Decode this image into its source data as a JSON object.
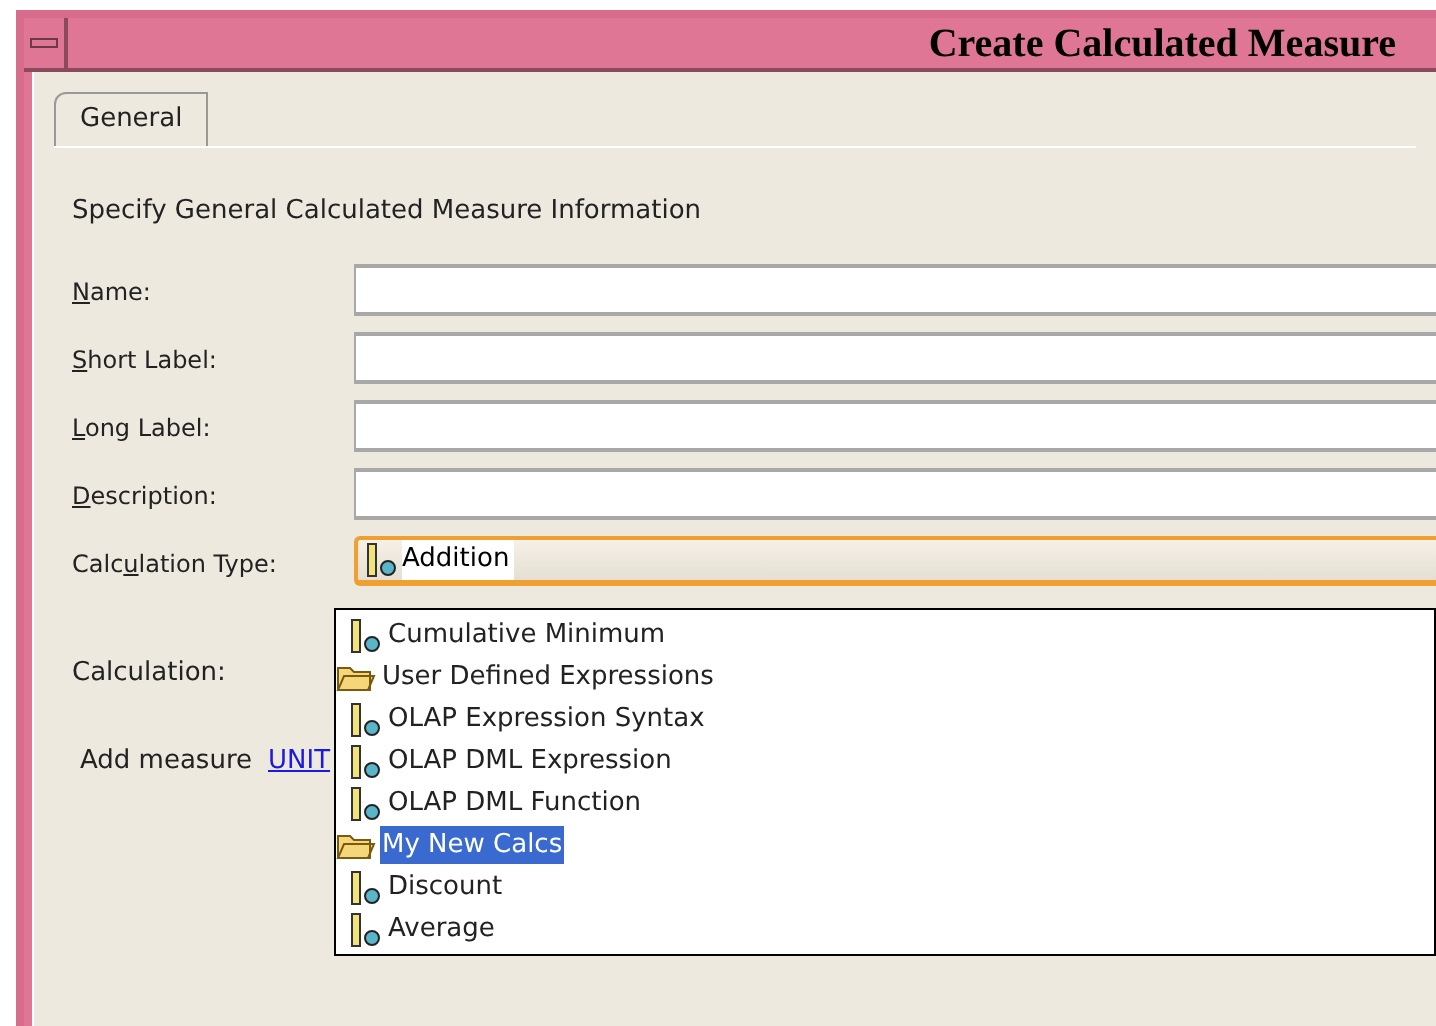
{
  "window": {
    "title": "Create Calculated Measure"
  },
  "tabs": [
    {
      "label": "General",
      "selected": true
    }
  ],
  "heading": "Specify General Calculated Measure Information",
  "fields": [
    {
      "label": [
        {
          "text": "N",
          "underlined": true
        },
        {
          "text": "ame:",
          "underlined": false
        }
      ]
    },
    {
      "label": [
        {
          "text": "S",
          "underlined": true
        },
        {
          "text": "hort Label:",
          "underlined": false
        }
      ]
    },
    {
      "label": [
        {
          "text": "L",
          "underlined": true
        },
        {
          "text": "ong Label:",
          "underlined": false
        }
      ]
    },
    {
      "label": [
        {
          "text": "D",
          "underlined": true
        },
        {
          "text": "escription:",
          "underlined": false
        }
      ]
    }
  ],
  "calculation_type": {
    "label": [
      {
        "text": "Calc",
        "underlined": false
      },
      {
        "text": "u",
        "underlined": true
      },
      {
        "text": "lation Type:",
        "underlined": false
      }
    ],
    "value": "Addition",
    "expanded": true,
    "options": [
      {
        "kind": "measure",
        "label": "Cumulative Minimum",
        "selected": false
      },
      {
        "kind": "folder",
        "label": "User Defined Expressions",
        "selected": false
      },
      {
        "kind": "measure",
        "label": "OLAP Expression Syntax",
        "selected": false
      },
      {
        "kind": "measure",
        "label": "OLAP DML Expression",
        "selected": false
      },
      {
        "kind": "measure",
        "label": "OLAP DML Function",
        "selected": false
      },
      {
        "kind": "folder",
        "label": "My New Calcs",
        "selected": true
      },
      {
        "kind": "measure",
        "label": "Discount",
        "selected": false
      },
      {
        "kind": "measure",
        "label": "Average",
        "selected": false
      }
    ]
  },
  "calculation": {
    "label": "Calculation:"
  },
  "add_measure": {
    "label": "Add measure",
    "link": "UNIT"
  }
}
